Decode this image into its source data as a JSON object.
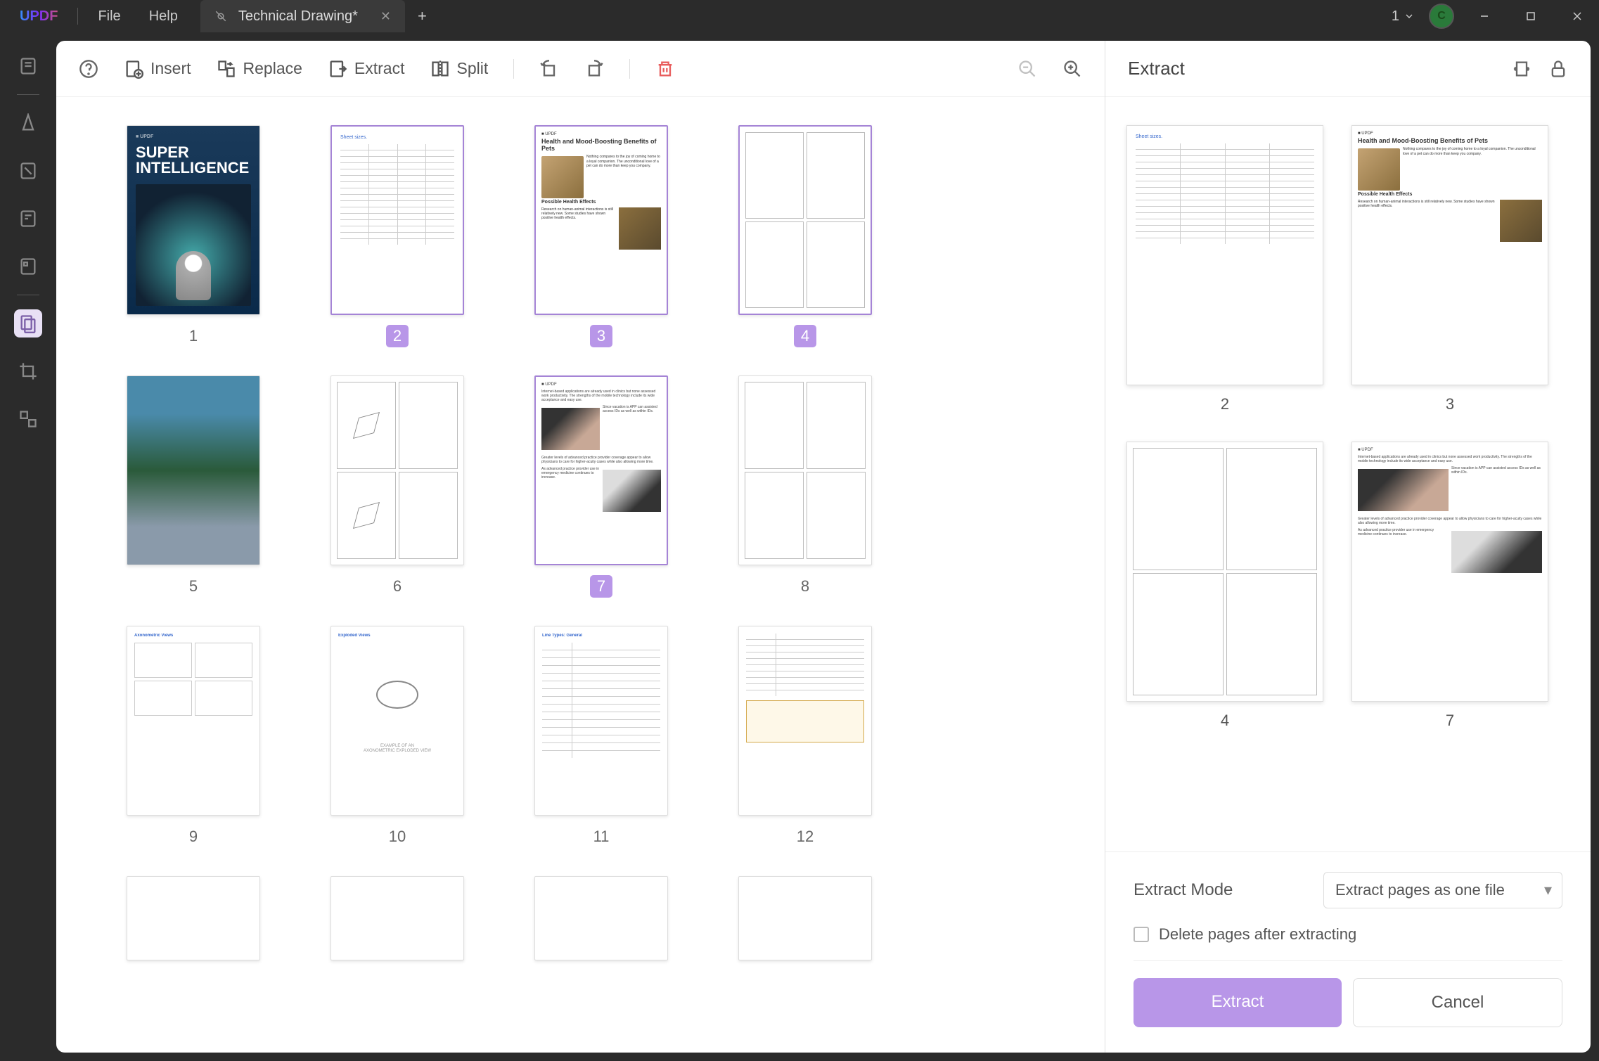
{
  "titlebar": {
    "logo": "UPDF",
    "menu": {
      "file": "File",
      "help": "Help"
    },
    "tab": {
      "title": "Technical Drawing*"
    },
    "tab_count": "1",
    "avatar_letter": "C"
  },
  "toolbar": {
    "insert": "Insert",
    "replace": "Replace",
    "extract": "Extract",
    "split": "Split"
  },
  "pages": [
    {
      "num": "1",
      "selected": false,
      "type": "dark",
      "title": "SUPER INTELLIGENCE"
    },
    {
      "num": "2",
      "selected": true,
      "type": "table"
    },
    {
      "num": "3",
      "selected": true,
      "type": "cat",
      "title": "Health and Mood-Boosting Benefits of Pets"
    },
    {
      "num": "4",
      "selected": true,
      "type": "tech"
    },
    {
      "num": "5",
      "selected": false,
      "type": "photo"
    },
    {
      "num": "6",
      "selected": false,
      "type": "ortho"
    },
    {
      "num": "7",
      "selected": true,
      "type": "person"
    },
    {
      "num": "8",
      "selected": false,
      "type": "tech"
    },
    {
      "num": "9",
      "selected": false,
      "type": "axo"
    },
    {
      "num": "10",
      "selected": false,
      "type": "exploded"
    },
    {
      "num": "11",
      "selected": false,
      "type": "lines"
    },
    {
      "num": "12",
      "selected": false,
      "type": "lines2"
    }
  ],
  "extract_panel": {
    "title": "Extract",
    "thumbs": [
      {
        "num": "2",
        "type": "table"
      },
      {
        "num": "3",
        "type": "cat"
      },
      {
        "num": "4",
        "type": "tech"
      },
      {
        "num": "7",
        "type": "person"
      }
    ],
    "mode_label": "Extract Mode",
    "mode_value": "Extract pages as one file",
    "checkbox_label": "Delete pages after extracting",
    "extract_btn": "Extract",
    "cancel_btn": "Cancel"
  }
}
